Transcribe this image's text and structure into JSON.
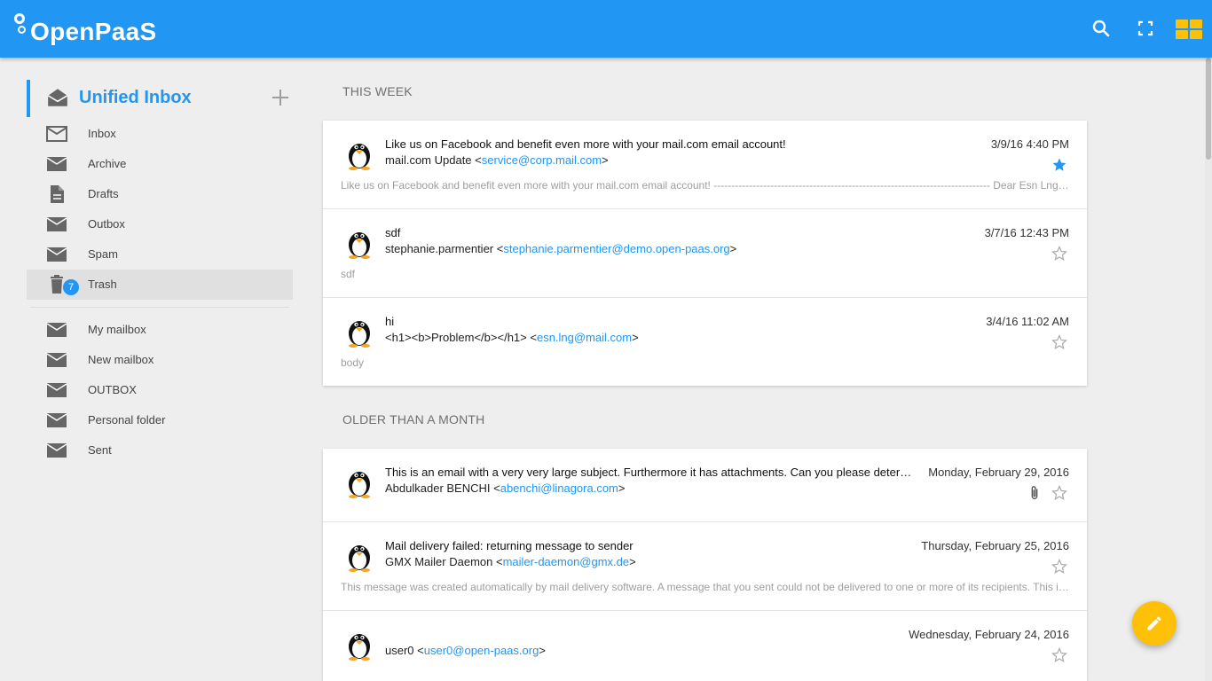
{
  "header": {
    "logo_text": "OpenPaaS"
  },
  "sidebar": {
    "unified_label": "Unified Inbox",
    "folders": [
      {
        "label": "Inbox",
        "icon": "inbox-icon"
      },
      {
        "label": "Archive",
        "icon": "mail-icon"
      },
      {
        "label": "Drafts",
        "icon": "document-icon"
      },
      {
        "label": "Outbox",
        "icon": "mail-icon"
      },
      {
        "label": "Spam",
        "icon": "mail-icon"
      },
      {
        "label": "Trash",
        "icon": "trash-icon",
        "badge": "7"
      }
    ],
    "custom_folders": [
      {
        "label": "My mailbox"
      },
      {
        "label": "New mailbox"
      },
      {
        "label": "OUTBOX"
      },
      {
        "label": "Personal folder"
      },
      {
        "label": "Sent"
      }
    ]
  },
  "sections": [
    {
      "title": "THIS WEEK",
      "emails": [
        {
          "subject": "Like us on Facebook and benefit even more with your mail.com email account!",
          "sender": "mail.com Update",
          "address": "service@corp.mail.com",
          "date": "3/9/16 4:40 PM",
          "starred": true,
          "preview": "Like us on Facebook and benefit even more with your mail.com email account! ------------------------------------------------------------------------------ Dear Esn Lng, Join our Facebook community to get exclusive access to the latest news"
        },
        {
          "subject": "sdf",
          "sender": "stephanie.parmentier",
          "address": "stephanie.parmentier@demo.open-paas.org",
          "date": "3/7/16 12:43 PM",
          "starred": false,
          "preview": "sdf"
        },
        {
          "subject": "hi",
          "sender": "<h1><b>Problem</b></h1>",
          "address": "esn.lng@mail.com",
          "date": "3/4/16 11:02 AM",
          "starred": false,
          "preview": "body"
        }
      ]
    },
    {
      "title": "OLDER THAN A MONTH",
      "emails": [
        {
          "subject": "This is an email with a very very large subject. Furthermore it has attachments. Can you please determine what is going on",
          "sender": "Abdulkader BENCHI",
          "address": "abenchi@linagora.com",
          "date": "Monday, February 29, 2016",
          "starred": false,
          "attachment": true,
          "preview": ""
        },
        {
          "subject": "Mail delivery failed: returning message to sender",
          "sender": "GMX Mailer Daemon",
          "address": "mailer-daemon@gmx.de",
          "date": "Thursday, February 25, 2016",
          "starred": false,
          "preview": "This message was created automatically by mail delivery software. A message that you sent could not be delivered to one or more of its recipients. This is a permanent error."
        },
        {
          "subject": "",
          "sender": "user0",
          "address": "user0@open-paas.org",
          "date": "Wednesday, February 24, 2016",
          "starred": false,
          "preview": ""
        }
      ]
    }
  ],
  "colors": {
    "primary": "#2196f3",
    "accent": "#ffc107"
  }
}
